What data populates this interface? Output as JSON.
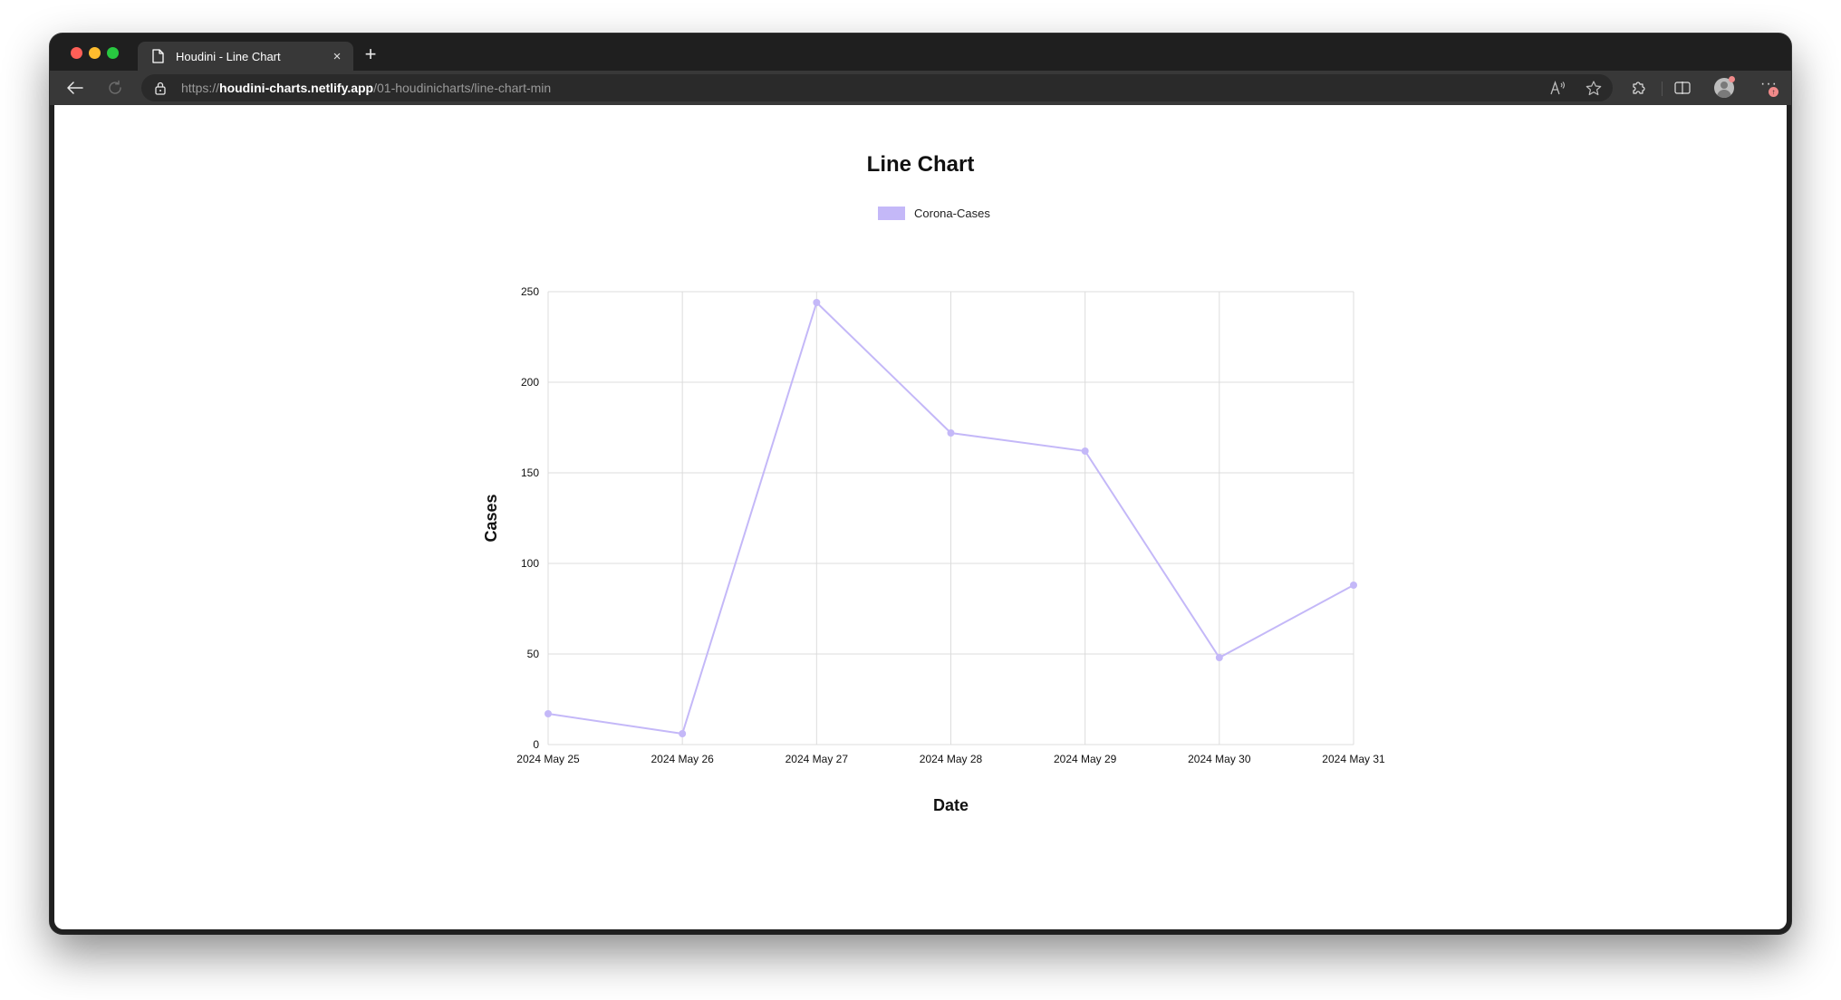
{
  "browser": {
    "tab_title": "Houdini - Line Chart",
    "tab_close_glyph": "×",
    "new_tab_glyph": "+",
    "url_scheme": "https://",
    "url_host": "houdini-charts.netlify.app",
    "url_path": "/01-houdinicharts/line-chart-min",
    "icons": [
      "back-icon",
      "reload-icon",
      "lock-icon",
      "read-aloud-icon",
      "favorite-star-icon",
      "extensions-icon",
      "split-screen-icon",
      "profile-avatar-icon",
      "more-icon"
    ],
    "more_glyph": "···",
    "update_badge_glyph": "↑"
  },
  "chart_data": {
    "type": "line",
    "title": "Line Chart",
    "xlabel": "Date",
    "ylabel": "Cases",
    "categories": [
      "2024 May 25",
      "2024 May 26",
      "2024 May 27",
      "2024 May 28",
      "2024 May 29",
      "2024 May 30",
      "2024 May 31"
    ],
    "series": [
      {
        "name": "Corona-Cases",
        "color": "#c4b8f8",
        "values": [
          17,
          6,
          244,
          172,
          162,
          48,
          88
        ]
      }
    ],
    "ylim": [
      0,
      250
    ],
    "yticks": [
      0,
      50,
      100,
      150,
      200,
      250
    ],
    "grid": true,
    "legend": "top-center"
  }
}
